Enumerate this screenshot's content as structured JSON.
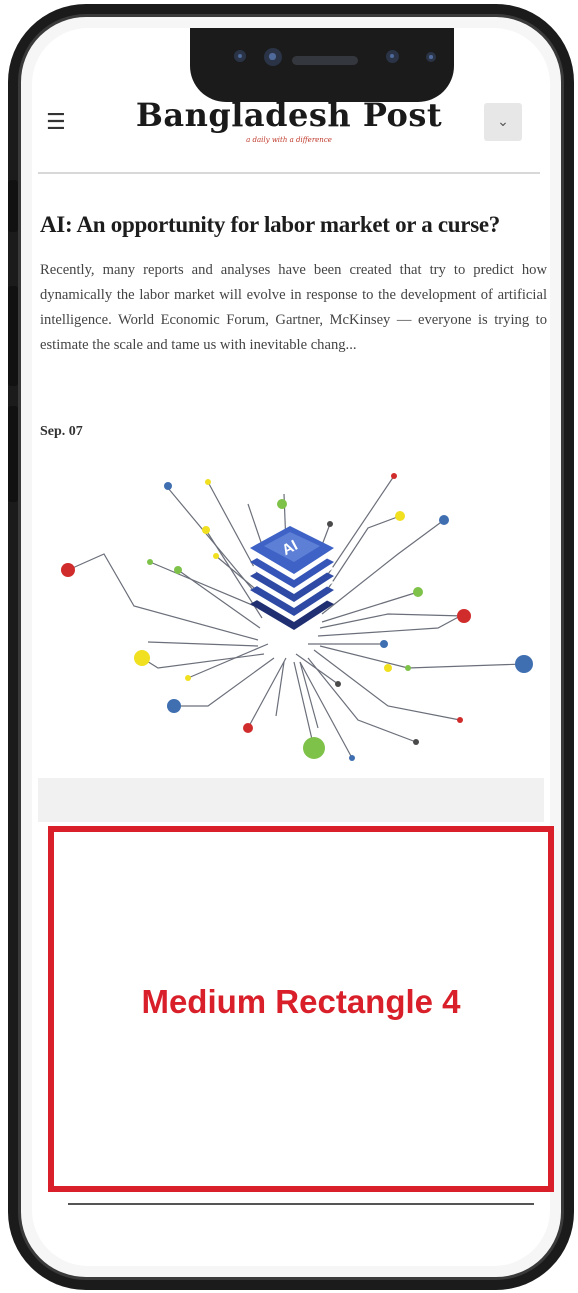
{
  "header": {
    "menu_icon": "hamburger-icon",
    "logo": "Bangladesh Post",
    "tagline": "a daily with a difference",
    "dropdown_icon": "chevron-down-icon"
  },
  "article": {
    "title": "AI: An opportunity for labor market or a curse?",
    "summary": "Recently, many reports and analyses have been created that try to predict how dynamically the labor market will evolve in response to the development of artificial intelligence. World Economic Forum, Gartner, McKinsey — everyone is trying to estimate the scale and tame us with inevitable chang...",
    "date": "Sep. 07",
    "image_label": "AI"
  },
  "ad": {
    "label": "Medium Rectangle 4"
  },
  "colors": {
    "ad_border": "#d9202a",
    "phone_frame": "#1b1b1b",
    "chip_blue": "#2f4aa8"
  }
}
